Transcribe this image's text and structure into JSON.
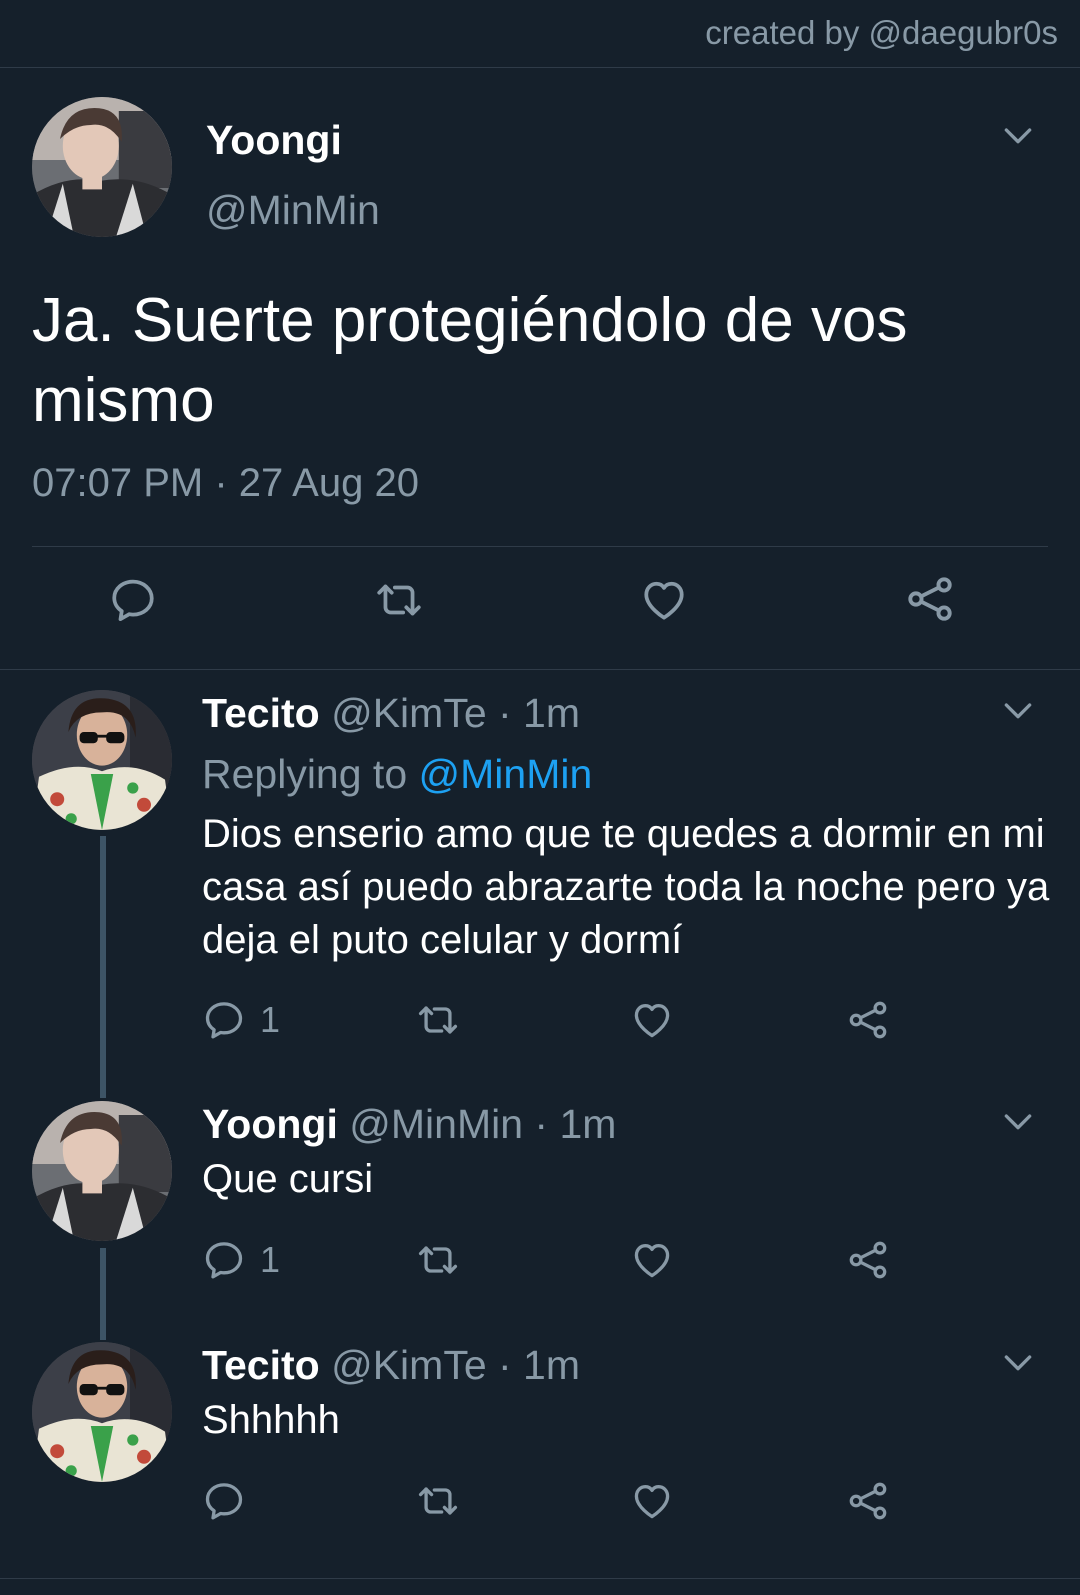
{
  "header": {
    "credit": "created by @daegubr0s"
  },
  "main_tweet": {
    "name": "Yoongi",
    "handle": "@MinMin",
    "text": "Ja. Suerte protegiéndolo de vos mismo",
    "timestamp": "07:07 PM · 27 Aug 20"
  },
  "replies": [
    {
      "name": "Tecito",
      "meta": " @KimTe · 1m",
      "replying_label": "Replying to ",
      "replying_handle": "@MinMin",
      "text": "Dios enserio amo que te quedes a dormir en mi casa así puedo abrazarte toda la noche pero ya deja el puto celular y dormí",
      "reply_count": "1"
    },
    {
      "name": "Yoongi",
      "meta": " @MinMin · 1m",
      "text": "Que cursi",
      "reply_count": "1"
    },
    {
      "name": "Tecito",
      "meta": " @KimTe · 1m",
      "text": "Shhhhh",
      "reply_count": ""
    }
  ],
  "icons": {
    "reply": "reply-icon",
    "retweet": "retweet-icon",
    "like": "heart-icon",
    "share": "share-icon",
    "menu": "chevron-down-icon"
  },
  "colors": {
    "background": "#15202b",
    "text": "#ffffff",
    "secondary": "#8899a6",
    "mention": "#1da1f2",
    "divider": "#2f3b48",
    "thread_line": "#3d5466"
  }
}
